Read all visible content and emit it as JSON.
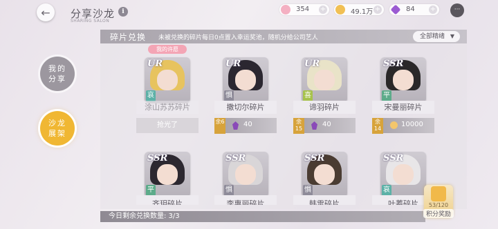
{
  "header": {
    "title": "分享沙龙",
    "subtitle": "SHARING SALON",
    "info_label": "i"
  },
  "currencies": [
    {
      "name": "diamond-currency",
      "value": "354",
      "color": "#f4b0c2"
    },
    {
      "name": "gold-currency",
      "value": "49.1万",
      "color": "#f1c054"
    },
    {
      "name": "crystal-currency",
      "value": "84",
      "color": "#9b5bd2"
    }
  ],
  "currency_plus": "+",
  "nav": {
    "share_label": "我的\n分享",
    "salon_label": "沙龙\n展架"
  },
  "panel": {
    "tab_label": "碎片兑换",
    "description": "未被兑换的碎片每日0点置入幸运奖池，随机分给公司艺人",
    "filter_label": "全部精绪",
    "filter_arrow": "▼"
  },
  "cards_row1": [
    {
      "rarity": "UR",
      "name": "涂山苏苏碎片",
      "attr": "哀",
      "attr_color": "#5cb1a7",
      "status": "抢光了",
      "wish": "我的许愿",
      "remain": "",
      "price": "",
      "hair": "#e7c35f"
    },
    {
      "rarity": "UR",
      "name": "撒切尔碎片",
      "attr": "惧",
      "attr_color": "#8e8b99",
      "status": "",
      "wish": "",
      "remain": "余6",
      "price": "40",
      "currency": "crystal",
      "hair": "#2b2730"
    },
    {
      "rarity": "UR",
      "name": "谛羽碎片",
      "attr": "喜",
      "attr_color": "#a7c24c",
      "status": "",
      "wish": "",
      "remain": "余15",
      "price": "40",
      "currency": "crystal",
      "hair": "#e9e3c8"
    },
    {
      "rarity": "SSR",
      "name": "宋曼丽碎片",
      "attr": "平",
      "attr_color": "#5dab8a",
      "status": "",
      "wish": "",
      "remain": "余14",
      "price": "10000",
      "currency": "gold",
      "hair": "#2a2829"
    }
  ],
  "cards_row2": [
    {
      "rarity": "SSR",
      "name": "齐玥碎片",
      "attr": "平",
      "attr_color": "#5dab8a",
      "hair": "#2c2830"
    },
    {
      "rarity": "SSR",
      "name": "李惠丽碎片",
      "attr": "惧",
      "attr_color": "#8e8b99",
      "hair": "#d9d6d8"
    },
    {
      "rarity": "SSR",
      "name": "韩雷碎片",
      "attr": "惧",
      "attr_color": "#8e8b99",
      "hair": "#4a3c32"
    },
    {
      "rarity": "SSR",
      "name": "叶蓁碎片",
      "attr": "哀",
      "attr_color": "#5cb1a7",
      "hair": "#e8e6e8"
    }
  ],
  "footer": {
    "remaining_text": "今日剩余兑换数量: 3/3"
  },
  "reward": {
    "progress": "53/120",
    "label": "积分奖励"
  },
  "chat_icon": "···"
}
